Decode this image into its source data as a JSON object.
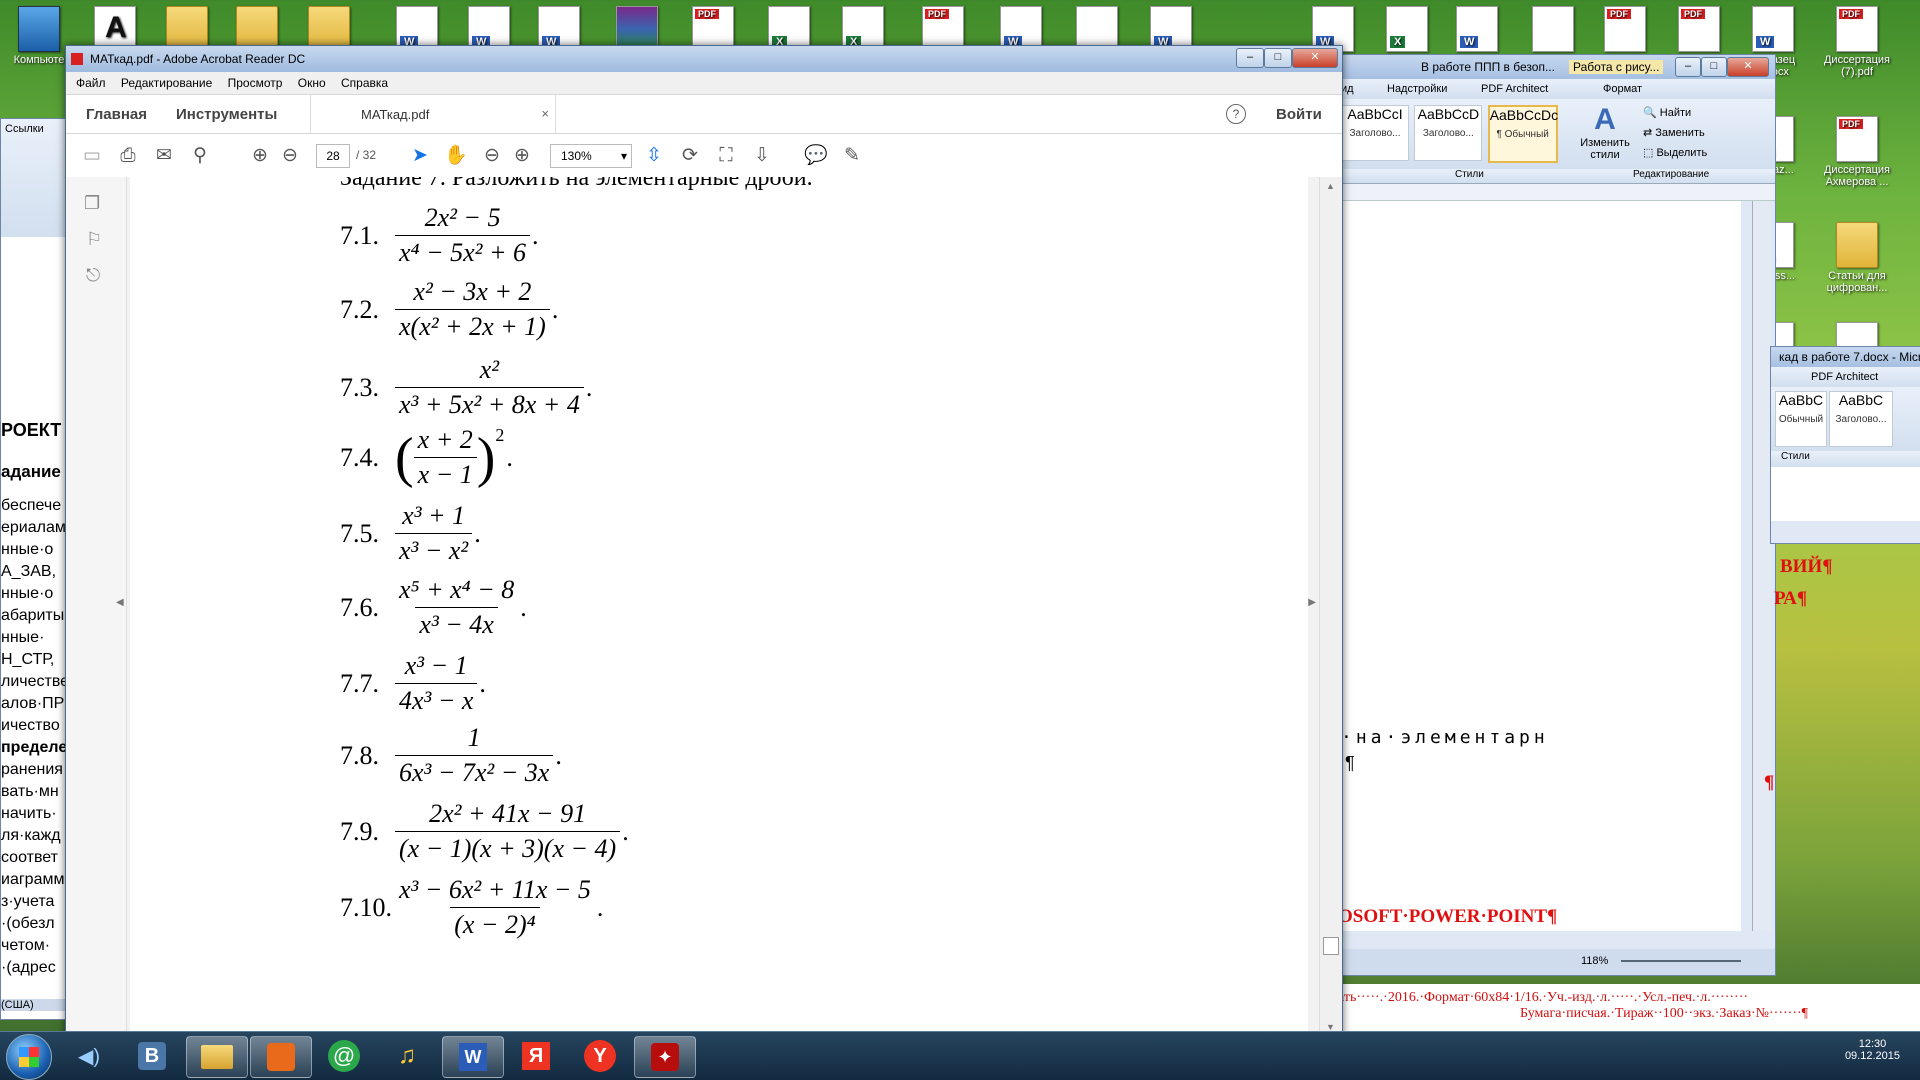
{
  "desktop": {
    "icons": [
      {
        "label": "Компьюте",
        "kind": "comp"
      },
      {
        "label": "",
        "kind": "acad"
      },
      {
        "label": "Образец T.docx",
        "kind": "word"
      },
      {
        "label": "Диссертация (7).pdf",
        "kind": "pdf"
      },
      {
        "label": "y_maz...",
        "kind": "mp3"
      },
      {
        "label": "Диссертация Ахмерова ...",
        "kind": "pdf"
      },
      {
        "label": "y_bass...",
        "kind": "mp3"
      },
      {
        "label": "Статьи для цифрован...",
        "kind": "folder"
      }
    ]
  },
  "word_bg": {
    "tabs": [
      "В работе ППП в безоп...",
      "Работа с рису..."
    ],
    "ribbon_tabs": [
      "ид",
      "Надстройки",
      "PDF Architect",
      "Формат"
    ],
    "styles": [
      "AaBbCcI",
      "AaBbCcD",
      "AaBbCcDc"
    ],
    "style_names": [
      "Заголово...",
      "Заголово...",
      "¶ Обычный"
    ],
    "change_styles": "Изменить стили",
    "edit": [
      "Найти",
      "Заменить",
      "Выделить"
    ],
    "group_styles": "Стили",
    "group_edit": "Редактирование",
    "doc_text": "·на·элементарн",
    "pilcrow": "¶",
    "red_lines": [
      "ВИЙ¶",
      "РА¶",
      "¶",
      "OSOFT·POWER·POINT¶"
    ],
    "zoom": "118%",
    "bottom_text": "ать·····.·2016.·Формат·60x84·1/16.·Уч.-изд.·л.·····.·Усл.-печ.·л.········",
    "bottom_text2": "Бумага·писчая.·Тираж··100··экз.·Заказ·№·······¶",
    "second_title": "кад в работе 7.docx - Micro",
    "second_pdf": "PDF Architect",
    "second_styles": [
      "AaBbC",
      "AaBbC"
    ],
    "second_style_names": [
      "Обычный",
      "Заголово..."
    ],
    "second_group": "Стили",
    "left_text": [
      "РОЕКТ",
      "адание",
      "беспече",
      "ериалам",
      "нные·о",
      "А_ЗАВ,",
      "нные·о",
      "абариты",
      "нные·",
      "Н_СТР,",
      "личестве",
      "алов·ПР",
      "ичество",
      "пределе",
      "ранения",
      "вать·мн",
      "начить·",
      "ля·кажд",
      "соответ",
      "иаграмм",
      "з·учета",
      "·(обезл",
      "четом·",
      "·(адрес"
    ],
    "left_status": "(США)",
    "left_tabs": "Ссылки"
  },
  "acrobat": {
    "title": "МАТкад.pdf - Adobe Acrobat Reader DC",
    "menu": [
      "Файл",
      "Редактирование",
      "Просмотр",
      "Окно",
      "Справка"
    ],
    "tab_home": "Главная",
    "tab_tools": "Инструменты",
    "doc_tab": "МАТкад.pdf",
    "signin": "Войти",
    "page_current": "28",
    "page_total": "/ 32",
    "zoom": "130%",
    "top_cut_text": "Задание 7. Разложить на элементарные дроби.",
    "problems": [
      {
        "num": "7.1.",
        "numer": "2x² − 5",
        "denom": "x⁴ − 5x² + 6"
      },
      {
        "num": "7.2.",
        "numer": "x² − 3x + 2",
        "denom": "x(x² + 2x + 1)"
      },
      {
        "num": "7.3.",
        "numer": "x²",
        "denom": "x³ + 5x² + 8x + 4"
      },
      {
        "num": "7.4.",
        "numer": "x + 2",
        "denom": "x − 1",
        "power": "2"
      },
      {
        "num": "7.5.",
        "numer": "x³ + 1",
        "denom": "x³ − x²"
      },
      {
        "num": "7.6.",
        "numer": "x⁵ + x⁴ − 8",
        "denom": "x³ − 4x"
      },
      {
        "num": "7.7.",
        "numer": "x³ − 1",
        "denom": "4x³ − x"
      },
      {
        "num": "7.8.",
        "numer": "1",
        "denom": "6x³ − 7x² − 3x"
      },
      {
        "num": "7.9.",
        "numer": "2x² + 41x − 91",
        "denom": "(x − 1)(x + 3)(x − 4)"
      },
      {
        "num": "7.10.",
        "numer": "x³ − 6x² + 11x − 5",
        "denom": "(x − 2)⁴"
      }
    ],
    "dot": "."
  },
  "taskbar": {
    "clock_time": "12:30",
    "clock_date": "09.12.2015",
    "items": [
      "start",
      "volume",
      "vk",
      "explorer",
      "media",
      "mail",
      "music",
      "word",
      "yandex",
      "yandex-browser",
      "acrobat"
    ]
  },
  "colors": {
    "accent_red": "#e01010",
    "acro_blue": "#1473e6"
  }
}
